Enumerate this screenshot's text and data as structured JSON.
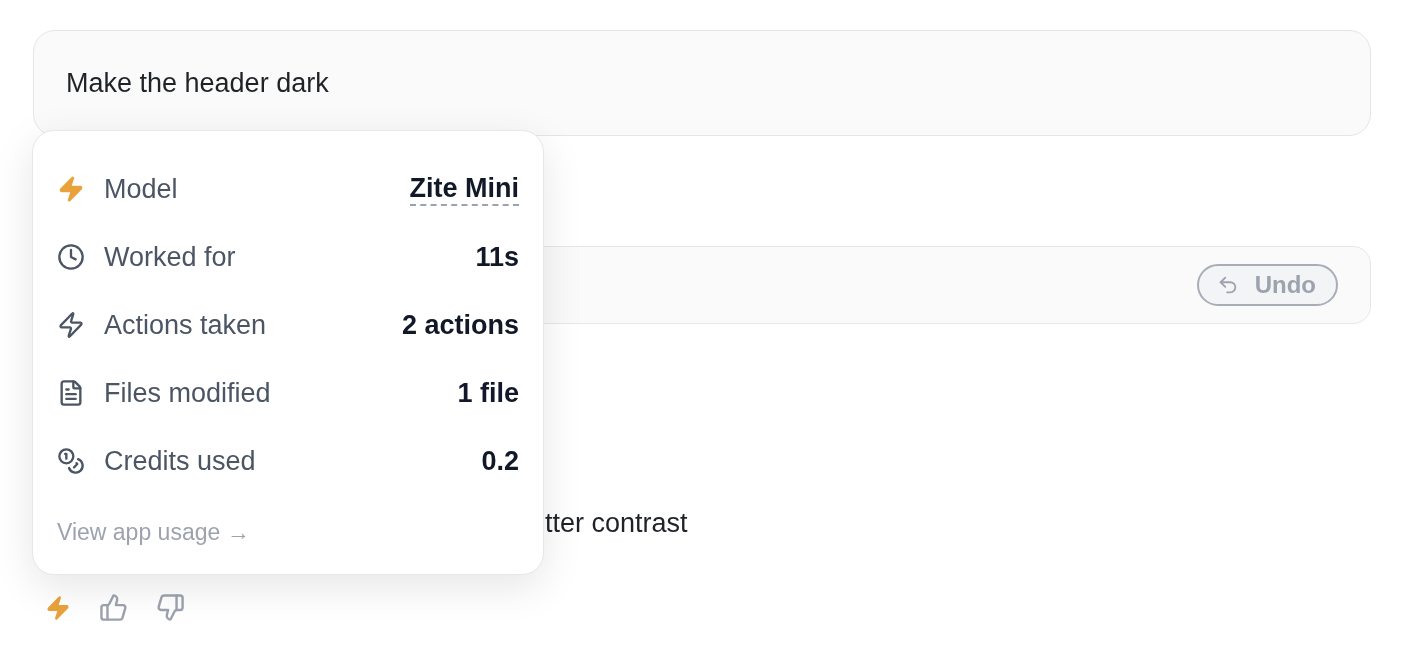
{
  "message": {
    "text": "Make the header dark"
  },
  "action_card": {
    "undo_button": {
      "label": "Undo",
      "disabled": true
    }
  },
  "response": {
    "text": "tter contrast"
  },
  "usage_popover": {
    "rows": [
      {
        "kind": "model",
        "label": "Model",
        "value": "Zite Mini"
      },
      {
        "kind": "time",
        "label": "Worked for",
        "value": "11s"
      },
      {
        "kind": "actions",
        "label": "Actions taken",
        "value": "2 actions"
      },
      {
        "kind": "files",
        "label": "Files modified",
        "value": "1 file"
      },
      {
        "kind": "credits",
        "label": "Credits used",
        "value": "0.2"
      }
    ],
    "link": "View app usage →"
  }
}
